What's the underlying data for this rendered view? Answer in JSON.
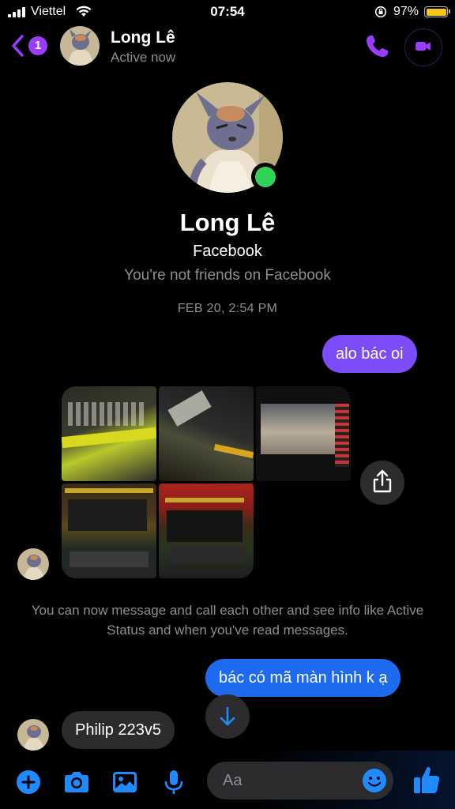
{
  "status_bar": {
    "carrier": "Viettel",
    "time": "07:54",
    "battery_percent": "97%",
    "battery_level": 0.97,
    "battery_color": "#f5c518"
  },
  "header": {
    "back_badge": "1",
    "name": "Long Lê",
    "status": "Active now",
    "accent_color": "#9b3dff",
    "icons": [
      "back-chevron-icon",
      "phone-icon",
      "video-camera-icon"
    ]
  },
  "profile": {
    "name": "Long Lê",
    "subtitle": "Facebook",
    "note": "You're not friends on Facebook",
    "online_color": "#31d158"
  },
  "conversation": {
    "timestamp": "FEB 20, 2:54 PM",
    "messages": [
      {
        "from": "me",
        "text": "alo bác oi",
        "color": "#7b4cf8"
      },
      {
        "from": "them",
        "type": "photos",
        "count": 5
      },
      {
        "from": "me",
        "text": "bác có mã màn hình k ạ",
        "color": "#1f6bf0"
      },
      {
        "from": "them",
        "text": "Philip 223v5"
      }
    ],
    "system_note": "You can now message and call each other and see info like Active Status and when you've read messages."
  },
  "composer": {
    "placeholder": "Aa",
    "icons": [
      "plus-icon",
      "camera-icon",
      "gallery-icon",
      "microphone-icon",
      "emoji-icon",
      "thumbs-up-icon"
    ],
    "accent_color": "#1f8bff"
  }
}
